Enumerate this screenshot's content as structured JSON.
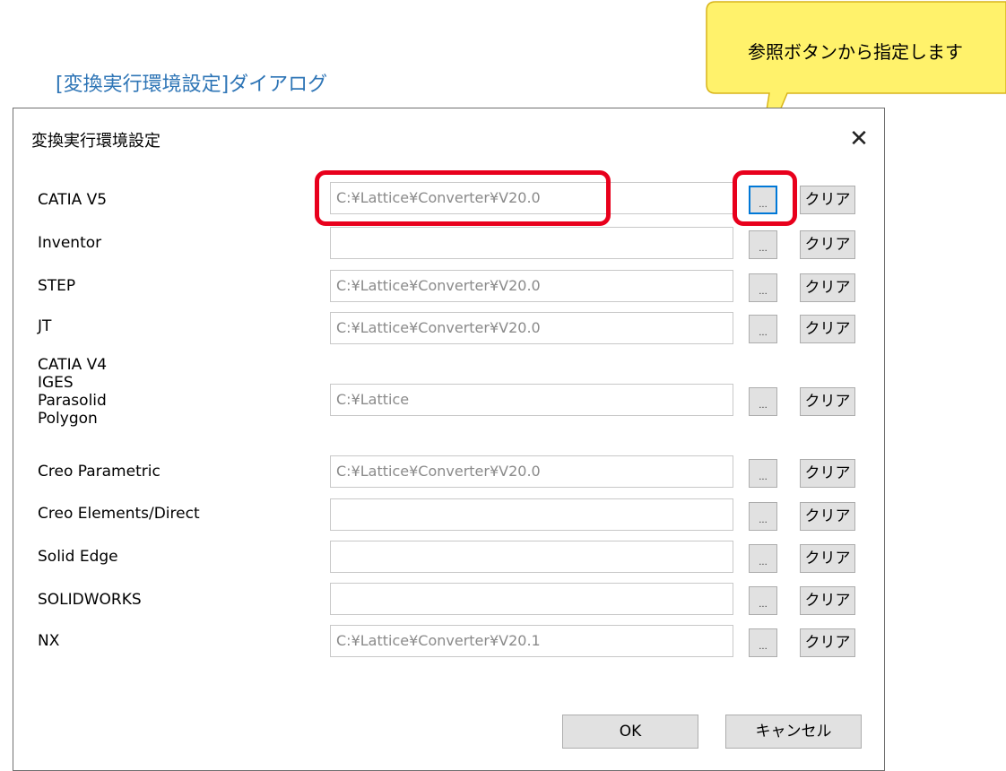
{
  "caption": "[変換実行環境設定]ダイアログ",
  "callout": {
    "text": "参照ボタンから指定します",
    "fill": "#fff26b",
    "stroke": "#d8b41a"
  },
  "highlight_color": "#e8001c",
  "dialog": {
    "title": "変換実行環境設定",
    "close_glyph": "✕",
    "browse_label": "...",
    "clear_label": "クリア",
    "ok_label": "OK",
    "cancel_label": "キャンセル",
    "rows": [
      {
        "label": "CATIA V5",
        "value": "C:¥Lattice¥Converter¥V20.0"
      },
      {
        "label": "Inventor",
        "value": ""
      },
      {
        "label": "STEP",
        "value": "C:¥Lattice¥Converter¥V20.0"
      },
      {
        "label": "JT",
        "value": "C:¥Lattice¥Converter¥V20.0"
      },
      {
        "label": "CATIA V4\nIGES\nParasolid\nPolygon",
        "value": "C:¥Lattice"
      },
      {
        "label": "Creo Parametric",
        "value": "C:¥Lattice¥Converter¥V20.0"
      },
      {
        "label": "Creo Elements/Direct",
        "value": ""
      },
      {
        "label": "Solid Edge",
        "value": ""
      },
      {
        "label": "SOLIDWORKS",
        "value": ""
      },
      {
        "label": "NX",
        "value": "C:¥Lattice¥Converter¥V20.1"
      }
    ]
  }
}
